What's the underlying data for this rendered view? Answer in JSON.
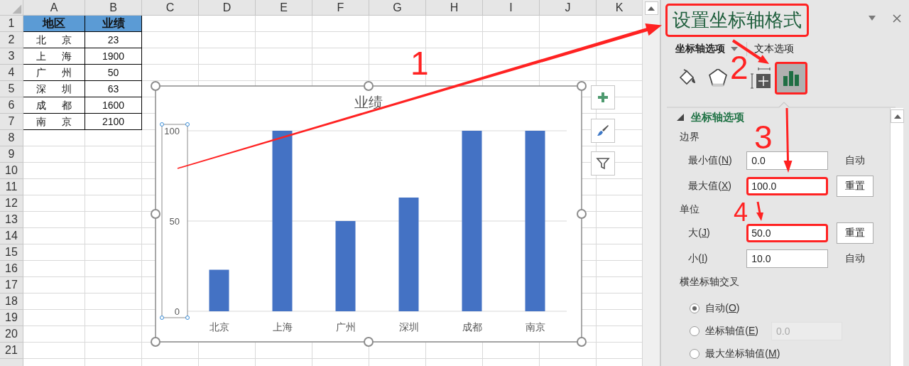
{
  "sheet": {
    "columns": [
      "A",
      "B",
      "C",
      "D",
      "E",
      "F",
      "G",
      "H",
      "I",
      "J",
      "K"
    ],
    "rows": [
      {
        "number": "1",
        "kind": "header",
        "cells": [
          "地区",
          "业绩"
        ]
      },
      {
        "number": "2",
        "kind": "data",
        "cells": [
          "北京",
          "23"
        ]
      },
      {
        "number": "3",
        "kind": "data",
        "cells": [
          "上海",
          "1900"
        ]
      },
      {
        "number": "4",
        "kind": "data",
        "cells": [
          "广州",
          "50"
        ]
      },
      {
        "number": "5",
        "kind": "data",
        "cells": [
          "深圳",
          "63"
        ]
      },
      {
        "number": "6",
        "kind": "data",
        "cells": [
          "成都",
          "1600"
        ]
      },
      {
        "number": "7",
        "kind": "data",
        "cells": [
          "南京",
          "2100"
        ]
      },
      {
        "number": "8"
      },
      {
        "number": "9"
      },
      {
        "number": "10"
      },
      {
        "number": "11"
      },
      {
        "number": "12"
      },
      {
        "number": "13"
      },
      {
        "number": "14"
      },
      {
        "number": "15"
      },
      {
        "number": "16"
      },
      {
        "number": "17"
      },
      {
        "number": "18"
      },
      {
        "number": "19"
      },
      {
        "number": "20"
      },
      {
        "number": "21"
      }
    ]
  },
  "chart": {
    "chart_data": {
      "type": "bar",
      "title": "业绩",
      "categories": [
        "北京",
        "上海",
        "广州",
        "深圳",
        "成都",
        "南京"
      ],
      "series": [
        {
          "color": "#4472c4",
          "values": [
            23,
            100,
            50,
            63,
            100,
            100
          ]
        }
      ],
      "ylim": [
        0,
        100
      ],
      "yticks": [
        0,
        50,
        100
      ]
    },
    "axis_selected": true
  },
  "panel": {
    "title": "设置坐标轴格式",
    "title_highlighted": true,
    "tabs": [
      {
        "label": "坐标轴选项",
        "selected": true
      },
      {
        "label": "文本选项",
        "selected": false
      }
    ],
    "icon_tabs": [
      {
        "kind": "fill",
        "selected": false,
        "highlighted": false
      },
      {
        "kind": "effects",
        "selected": false,
        "highlighted": false
      },
      {
        "kind": "size",
        "selected": false,
        "highlighted": false
      },
      {
        "kind": "axis",
        "selected": true,
        "highlighted": true
      }
    ],
    "section": {
      "title": "坐标轴选项",
      "expanded": true
    },
    "items": [
      {
        "kind": "heading",
        "text": "边界"
      },
      {
        "kind": "field",
        "label": [
          "最小值(",
          "N",
          ")"
        ],
        "value": "0.0",
        "action": {
          "kind": "text",
          "text": "自动"
        },
        "highlighted": false
      },
      {
        "kind": "field",
        "label": [
          "最大值(",
          "X",
          ")"
        ],
        "value": "100.0",
        "action": {
          "kind": "button",
          "text": "重置"
        },
        "highlighted": true
      },
      {
        "kind": "heading",
        "text": "单位"
      },
      {
        "kind": "field",
        "label": [
          "大(",
          "J",
          ")"
        ],
        "value": "50.0",
        "action": {
          "kind": "button",
          "text": "重置"
        },
        "highlighted": true
      },
      {
        "kind": "field",
        "label": [
          "小(",
          "I",
          ")"
        ],
        "value": "10.0",
        "action": {
          "kind": "text",
          "text": "自动"
        },
        "highlighted": false
      },
      {
        "kind": "heading",
        "text": "横坐标轴交叉"
      },
      {
        "kind": "radio",
        "label": [
          "自动(",
          "O",
          ")"
        ],
        "selected": true
      },
      {
        "kind": "radio",
        "label": [
          "坐标轴值(",
          "E",
          ")"
        ],
        "selected": false,
        "value": "0.0",
        "disabled": true
      },
      {
        "kind": "radio",
        "label": [
          "最大坐标轴值(",
          "M",
          ")"
        ],
        "selected": false
      }
    ]
  },
  "annotations": [
    {
      "number": "1"
    },
    {
      "number": "2"
    },
    {
      "number": "3"
    },
    {
      "number": "4"
    }
  ]
}
